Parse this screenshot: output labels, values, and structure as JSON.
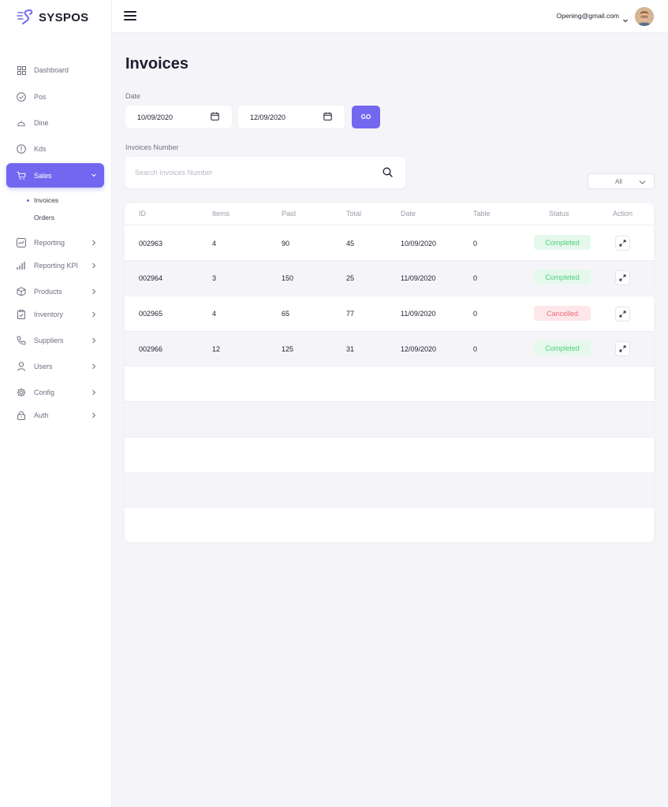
{
  "brand": {
    "name": "SYSPOS"
  },
  "topbar": {
    "email": "Opening@gmail.com"
  },
  "sidebar": {
    "items": [
      {
        "label": "Dashboard",
        "icon": "grid-icon"
      },
      {
        "label": "Pos",
        "icon": "check-circle-icon"
      },
      {
        "label": "Dine",
        "icon": "cloche-icon"
      },
      {
        "label": "Kds",
        "icon": "alert-circle-icon"
      },
      {
        "label": "Sales",
        "icon": "cart-icon",
        "active": true
      },
      {
        "label": "Reporting",
        "icon": "chart-line-icon"
      },
      {
        "label": "Reporting KPI",
        "icon": "bar-chart-icon"
      },
      {
        "label": "Products",
        "icon": "box-icon"
      },
      {
        "label": "Inventory",
        "icon": "clipboard-icon"
      },
      {
        "label": "Suppliers",
        "icon": "phone-icon"
      },
      {
        "label": "Users",
        "icon": "user-icon"
      },
      {
        "label": "Config",
        "icon": "gear-icon"
      },
      {
        "label": "Auth",
        "icon": "lock-icon"
      }
    ],
    "sub_items": [
      {
        "label": "Invoices",
        "active": true
      },
      {
        "label": "Orders"
      }
    ]
  },
  "page": {
    "title": "Invoices",
    "date_label": "Date",
    "date_from": "10/09/2020",
    "date_to": "12/09/2020",
    "go_label": "GO",
    "invoice_number_label": "Invoices Number",
    "search_placeholder": "Search Invoices Number",
    "filter_value": "All"
  },
  "table": {
    "headers": [
      "ID",
      "Items",
      "Paid",
      "Total",
      "Date",
      "Table",
      "Status",
      "Action"
    ],
    "rows": [
      {
        "id": "002963",
        "items": "4",
        "paid": "90",
        "total": "45",
        "date": "10/09/2020",
        "table": "0",
        "status": "Completed"
      },
      {
        "id": "002964",
        "items": "3",
        "paid": "150",
        "total": "25",
        "date": "11/09/2020",
        "table": "0",
        "status": "Completed"
      },
      {
        "id": "002965",
        "items": "4",
        "paid": "65",
        "total": "77",
        "date": "11/09/2020",
        "table": "0",
        "status": "Cancelled"
      },
      {
        "id": "002966",
        "items": "12",
        "paid": "125",
        "total": "31",
        "date": "12/09/2020",
        "table": "0",
        "status": "Completed"
      }
    ]
  },
  "colors": {
    "accent": "#7367f0",
    "success": "#4cd17d",
    "danger": "#f06a78"
  }
}
